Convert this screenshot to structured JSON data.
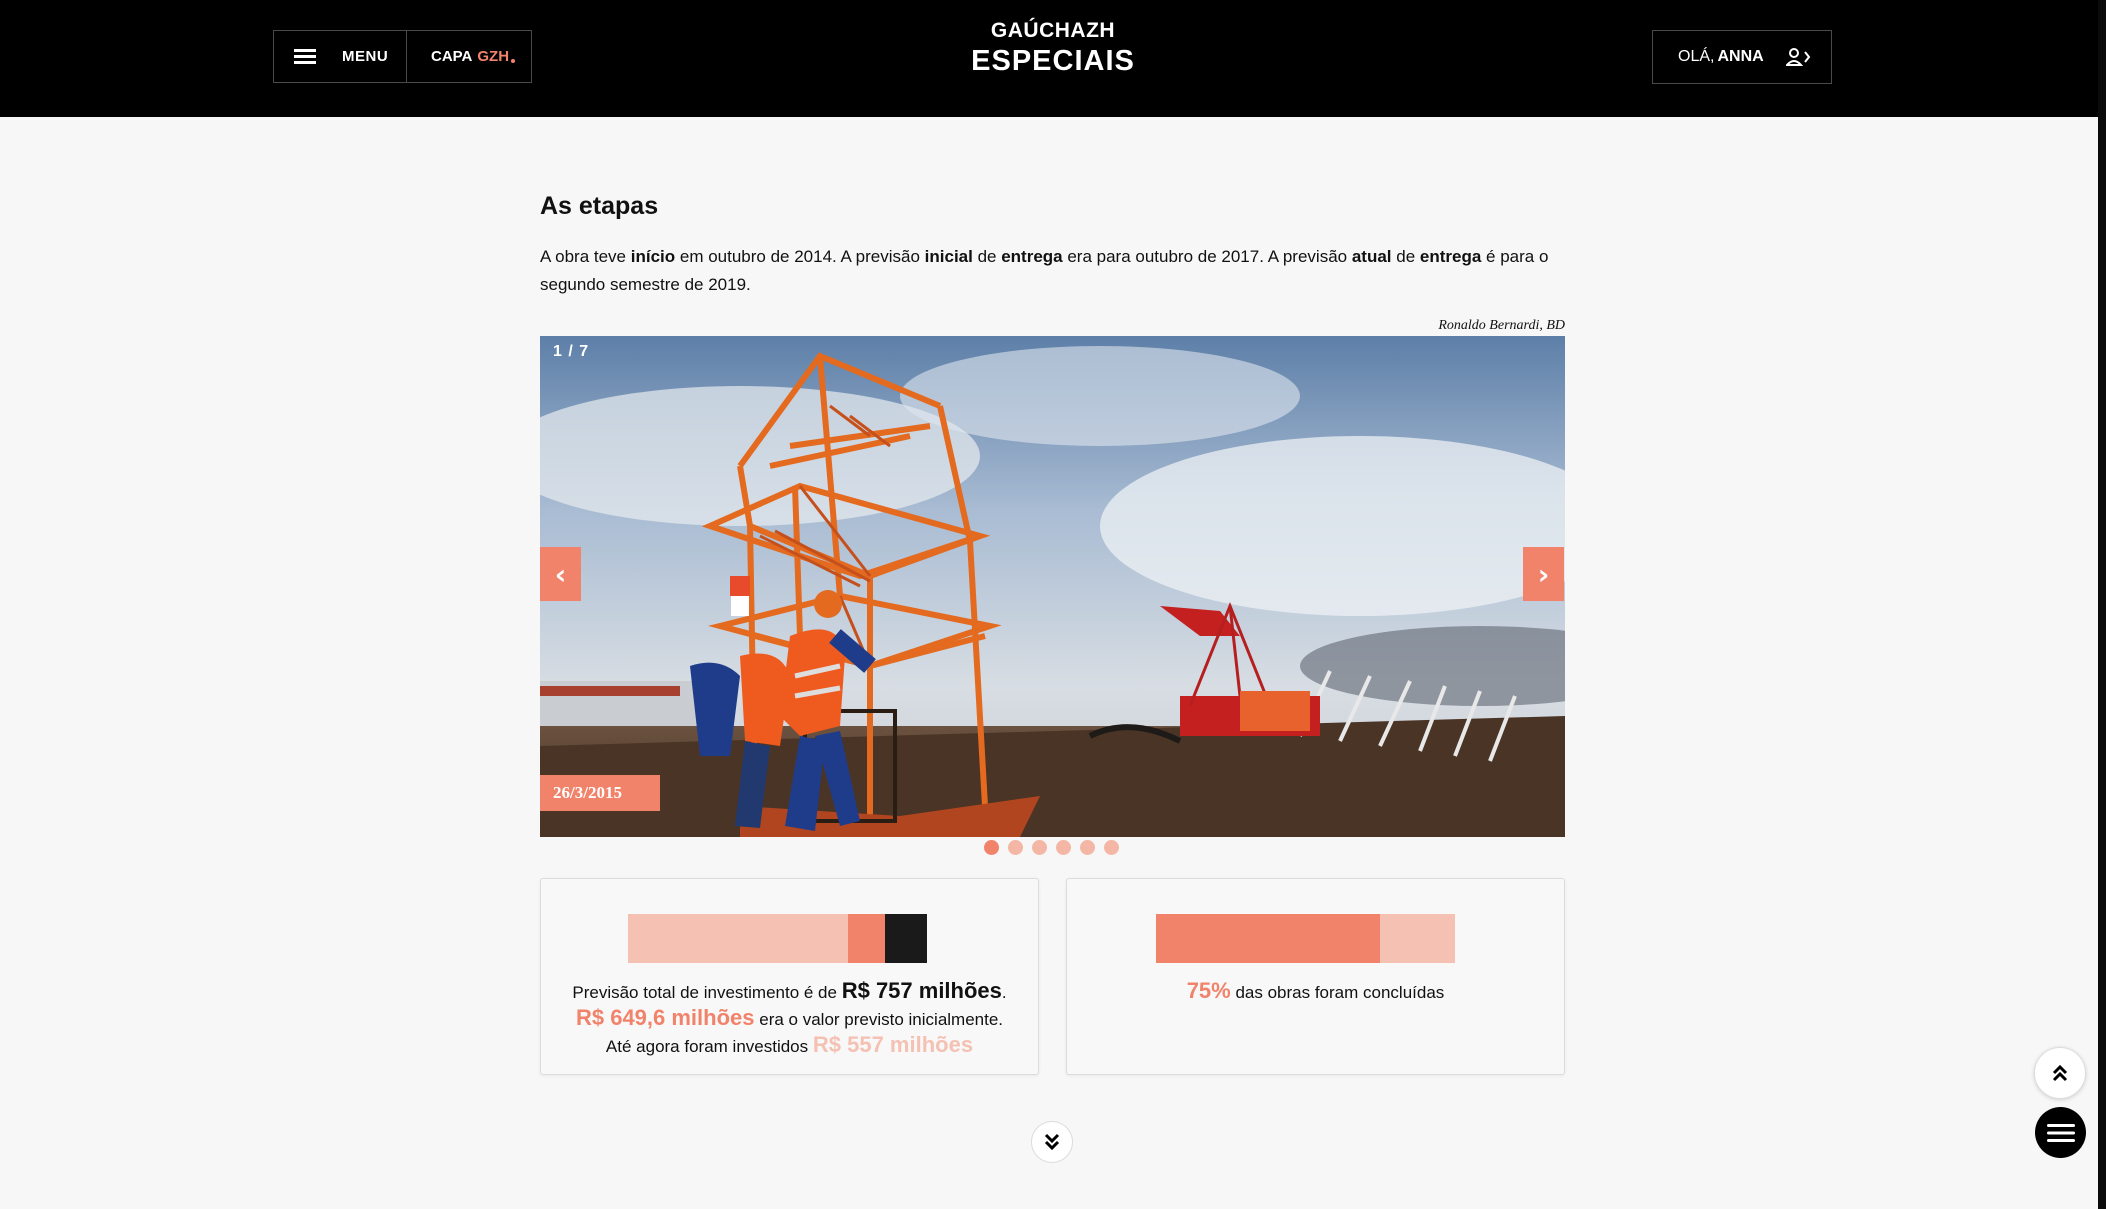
{
  "header": {
    "menu_label": "MENU",
    "capa_label": "CAPA",
    "capa_brand": "GZH",
    "logo_line1": "GAÚCHAZH",
    "logo_line2": "ESPECIAIS",
    "greeting": "OLÁ,",
    "user_name": "ANNA"
  },
  "article": {
    "section_title": "As etapas",
    "intro": [
      {
        "t": "A obra teve ",
        "b": false
      },
      {
        "t": "início",
        "b": true
      },
      {
        "t": " em outubro de 2014. A previsão ",
        "b": false
      },
      {
        "t": "inicial",
        "b": true
      },
      {
        "t": " de ",
        "b": false
      },
      {
        "t": "entrega",
        "b": true
      },
      {
        "t": " era para outubro de 2017. A previsão ",
        "b": false
      },
      {
        "t": "atual",
        "b": true
      },
      {
        "t": " de ",
        "b": false
      },
      {
        "t": "entrega",
        "b": true
      },
      {
        "t": " é para o segundo semestre de 2019.",
        "b": false
      }
    ],
    "photo_credit": "Ronaldo Bernardi, BD"
  },
  "slider": {
    "counter": "1 / 7",
    "prev_icon": "chevron-left-icon",
    "next_icon": "chevron-right-icon",
    "prev_glyph": "‹",
    "next_glyph": "›",
    "date": "26/3/2015",
    "dots_count": 6,
    "active_dot": 0
  },
  "investment_card": {
    "line1_prefix": "Previsão total de investimento é de ",
    "total": "R$ 757 milhões",
    "line1_suffix": ".",
    "initial": "R$ 649,6 milhões",
    "line2_suffix": " era o valor previsto inicialmente.",
    "line3_prefix": "Até agora foram investidos ",
    "invested": "R$ 557 milhões",
    "values": {
      "invested": 557,
      "initial": 649.6,
      "total": 757
    }
  },
  "progress_card": {
    "percent_label": "75%",
    "text": " das obras foram concluídas",
    "percent": 75
  },
  "colors": {
    "accent": "#f2836b",
    "pale": "#f4c1b3",
    "dark": "#1a1a1a"
  }
}
